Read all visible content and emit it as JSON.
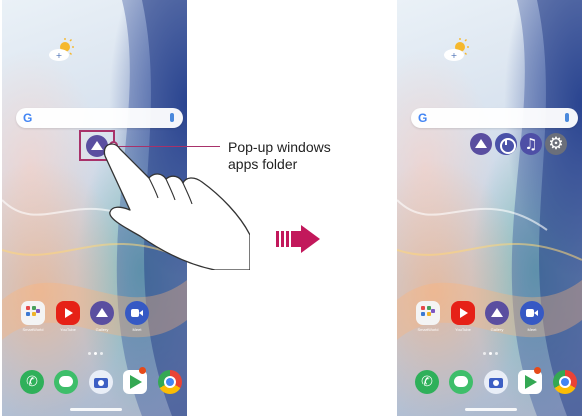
{
  "callout": {
    "line1": "Pop-up windows",
    "line2": "apps folder"
  },
  "search": {
    "logo": "G"
  },
  "left_screen": {
    "apps": [
      {
        "label": "SmartWorld",
        "icon": "smart-world-icon"
      },
      {
        "label": "YouTube",
        "icon": "youtube-icon"
      },
      {
        "label": "Gallery",
        "icon": "gallery-icon"
      },
      {
        "label": "Meet",
        "icon": "meet-icon"
      }
    ],
    "folder_icon": "popup-windows-folder-icon"
  },
  "right_screen": {
    "apps": [
      {
        "label": "SmartWorld",
        "icon": "smart-world-icon"
      },
      {
        "label": "YouTube",
        "icon": "youtube-icon"
      },
      {
        "label": "Gallery",
        "icon": "gallery-icon"
      },
      {
        "label": "Meet",
        "icon": "meet-icon"
      }
    ],
    "popup_items": [
      "popup-windows-folder-icon",
      "clock-icon",
      "music-icon",
      "settings-icon"
    ]
  },
  "dock": [
    "phone-icon",
    "messages-icon",
    "camera-icon",
    "play-store-icon",
    "chrome-icon"
  ],
  "colors": {
    "accent": "#a8326a",
    "arrow": "#c2185b",
    "folder": "#5a4ea0"
  }
}
